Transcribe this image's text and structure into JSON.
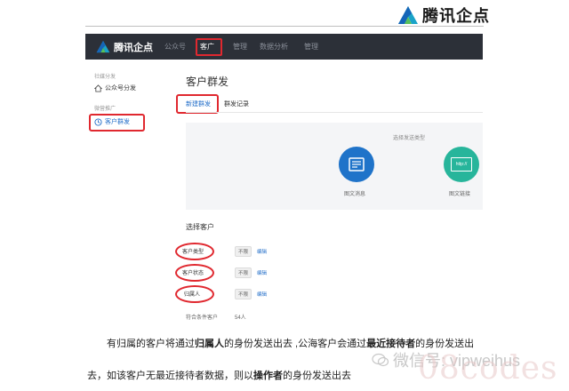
{
  "brand": {
    "name": "腾讯企点"
  },
  "nav": {
    "items": [
      {
        "label": "公众号",
        "active": false
      },
      {
        "label": "客广",
        "active": true
      },
      {
        "label": "管理",
        "active": false
      },
      {
        "label": "数据分析",
        "active": false
      },
      {
        "label": "管理",
        "active": false
      }
    ]
  },
  "sidebar": {
    "groups": [
      {
        "title": "社媒分发",
        "items": [
          {
            "label": "公众号分发",
            "icon": "home-icon"
          }
        ]
      },
      {
        "title": "微营推广",
        "items": [
          {
            "label": "客户群发",
            "icon": "clock-icon",
            "selected": true
          }
        ]
      }
    ]
  },
  "main": {
    "title": "客户群发",
    "tabs": [
      {
        "label": "新建群发",
        "active": true
      },
      {
        "label": "群发记录",
        "active": false
      }
    ],
    "send_type": {
      "title": "选择发送类型",
      "options": [
        {
          "label": "图文消息",
          "icon": "document-icon",
          "color": "#1f73c9"
        },
        {
          "label": "图文链接",
          "icon": "link-icon",
          "color": "#27b59b",
          "glyph": "http://"
        }
      ]
    },
    "customers": {
      "title": "选择客户",
      "fields": [
        {
          "label": "客户类型",
          "value": "不限",
          "action": "编辑"
        },
        {
          "label": "客户状态",
          "value": "不限",
          "action": "编辑"
        },
        {
          "label": "归属人",
          "value": "不限",
          "action": "编辑"
        }
      ],
      "match_label": "符合条件客户",
      "match_value": "54人"
    }
  },
  "caption": {
    "line1": [
      {
        "text": "有归属的客户将通过",
        "bold": false
      },
      {
        "text": "归属人",
        "bold": true
      },
      {
        "text": "的身份发送出去 ,公海客户会通过",
        "bold": false
      },
      {
        "text": "最近接待者",
        "bold": true
      },
      {
        "text": "的身份发送出",
        "bold": false
      }
    ],
    "line2": [
      {
        "text": "去，如该客户无最近接待者数据，则以",
        "bold": false
      },
      {
        "text": "操作者",
        "bold": true
      },
      {
        "text": "的身份发送出去",
        "bold": false
      }
    ]
  },
  "watermark": {
    "text": "微信号: vipweihus",
    "big": "08codes"
  },
  "colors": {
    "accent": "#1f6cc8",
    "highlight": "#e0282f",
    "nav_bg": "#2c3038"
  }
}
